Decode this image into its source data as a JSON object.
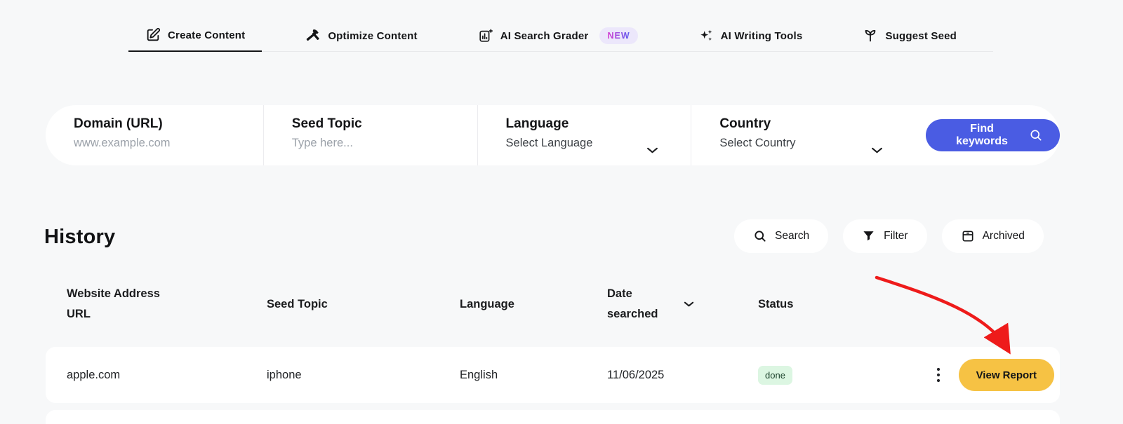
{
  "tabs": [
    {
      "label": "Create Content",
      "icon": "edit-icon",
      "active": true
    },
    {
      "label": "Optimize Content",
      "icon": "hammer-icon",
      "active": false
    },
    {
      "label": "AI Search Grader",
      "icon": "grader-chart-icon",
      "active": false,
      "badge": "NEW"
    },
    {
      "label": "AI Writing Tools",
      "icon": "sparkles-icon",
      "active": false
    },
    {
      "label": "Suggest Seed",
      "icon": "seedling-icon",
      "active": false
    }
  ],
  "search_form": {
    "fields": [
      {
        "label": "Domain (URL)",
        "placeholder": "www.example.com",
        "type": "input"
      },
      {
        "label": "Seed Topic",
        "placeholder": "Type here...",
        "type": "input"
      },
      {
        "label": "Language",
        "value": "Select Language",
        "type": "select"
      },
      {
        "label": "Country",
        "value": "Select Country",
        "type": "select"
      }
    ],
    "submit": {
      "label": "Find keywords",
      "icon": "search-icon"
    }
  },
  "history": {
    "title": "History",
    "toolbar": [
      {
        "label": "Search",
        "icon": "search-icon"
      },
      {
        "label": "Filter",
        "icon": "filter-icon"
      },
      {
        "label": "Archived",
        "icon": "archive-icon"
      }
    ],
    "table": {
      "columns": [
        "Website Address URL",
        "Seed Topic",
        "Language",
        "Date searched",
        "Status"
      ],
      "sorted_column": "Date searched",
      "rows": [
        {
          "website": "apple.com",
          "seed_topic": "iphone",
          "language": "English",
          "date_searched": "11/06/2025",
          "status": "done",
          "action_label": "View Report"
        }
      ]
    }
  },
  "annotation": {
    "type": "arrow",
    "color": "#ee1b1b",
    "points_to": "view-report-button"
  },
  "colors": {
    "page_background": "#f7f8f9",
    "card_background": "#ffffff",
    "primary_button": "#4a5ce3",
    "report_button": "#f6c244",
    "status_done_bg": "#dcf6e2",
    "new_badge_bg": "#ece7fb",
    "new_badge_gradient": [
      "#d83ad0",
      "#5b5ef0"
    ],
    "annotation_arrow": "#ee1b1b",
    "text": "#17181a",
    "placeholder": "#9ba1a9"
  }
}
